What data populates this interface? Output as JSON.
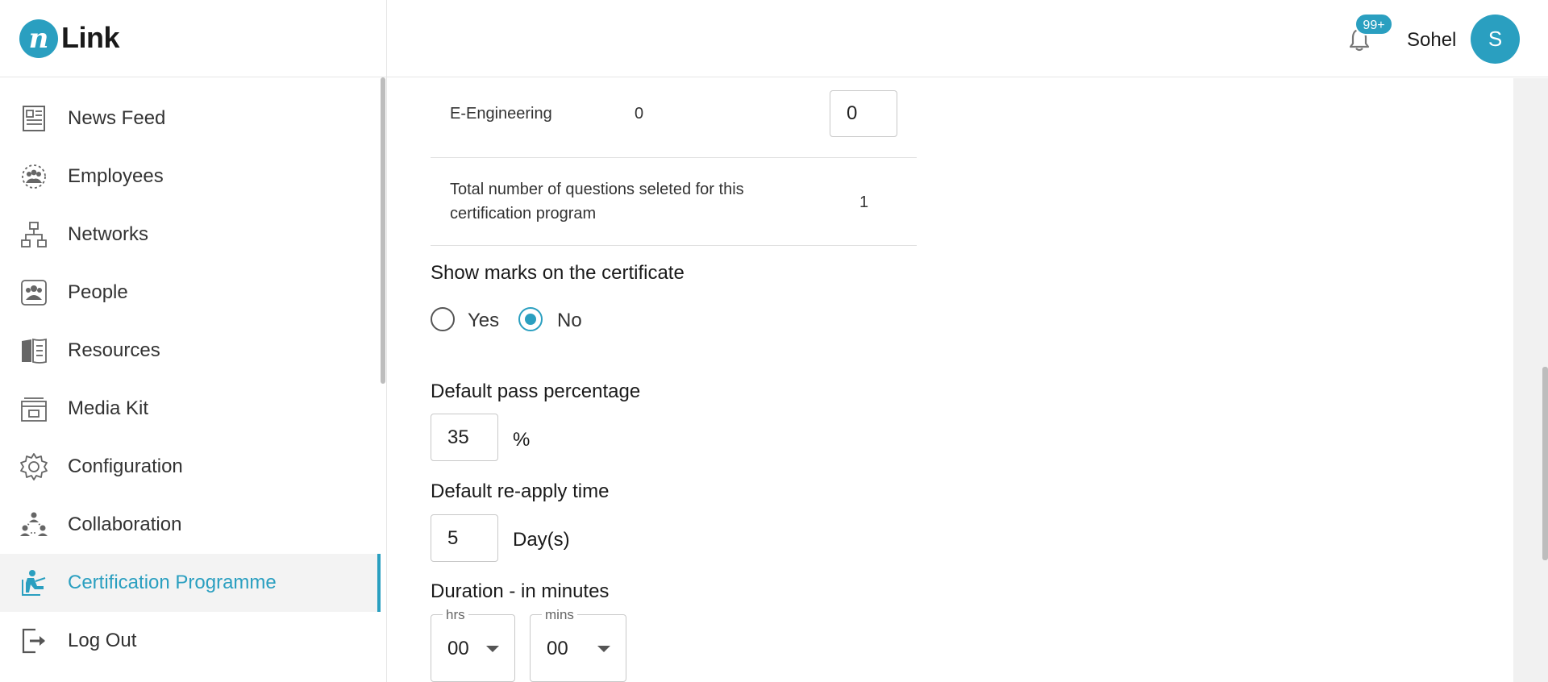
{
  "header": {
    "logo_mark": "n",
    "logo_text": "Link",
    "notification_count": "99+",
    "user_name": "Sohel",
    "avatar_initial": "S"
  },
  "sidebar": {
    "items": [
      {
        "label": "News Feed",
        "icon": "news-feed-icon"
      },
      {
        "label": "Employees",
        "icon": "employees-icon"
      },
      {
        "label": "Networks",
        "icon": "networks-icon"
      },
      {
        "label": "People",
        "icon": "people-icon"
      },
      {
        "label": "Resources",
        "icon": "resources-icon"
      },
      {
        "label": "Media Kit",
        "icon": "media-kit-icon"
      },
      {
        "label": "Configuration",
        "icon": "gear-icon"
      },
      {
        "label": "Collaboration",
        "icon": "collaboration-icon"
      },
      {
        "label": "Certification Programme",
        "icon": "certification-icon",
        "active": true
      },
      {
        "label": "Log Out",
        "icon": "logout-icon"
      }
    ]
  },
  "questions": {
    "row_label": "E-Engineering",
    "row_available": "0",
    "row_selected": "0",
    "total_label_line1": "Total number of questions seleted for this",
    "total_label_line2": "certification program",
    "total_value": "1"
  },
  "show_marks": {
    "title": "Show marks on the certificate",
    "option_yes": "Yes",
    "option_no": "No",
    "selected": "No"
  },
  "pass_percentage": {
    "title": "Default pass percentage",
    "value": "35",
    "unit": "%"
  },
  "reapply": {
    "title": "Default re-apply time",
    "value": "5",
    "unit": "Day(s)"
  },
  "duration": {
    "title": "Duration - in minutes",
    "hrs_label": "hrs",
    "hrs_value": "00",
    "mins_label": "mins",
    "mins_value": "00"
  },
  "colors": {
    "accent": "#2a9fc0"
  }
}
